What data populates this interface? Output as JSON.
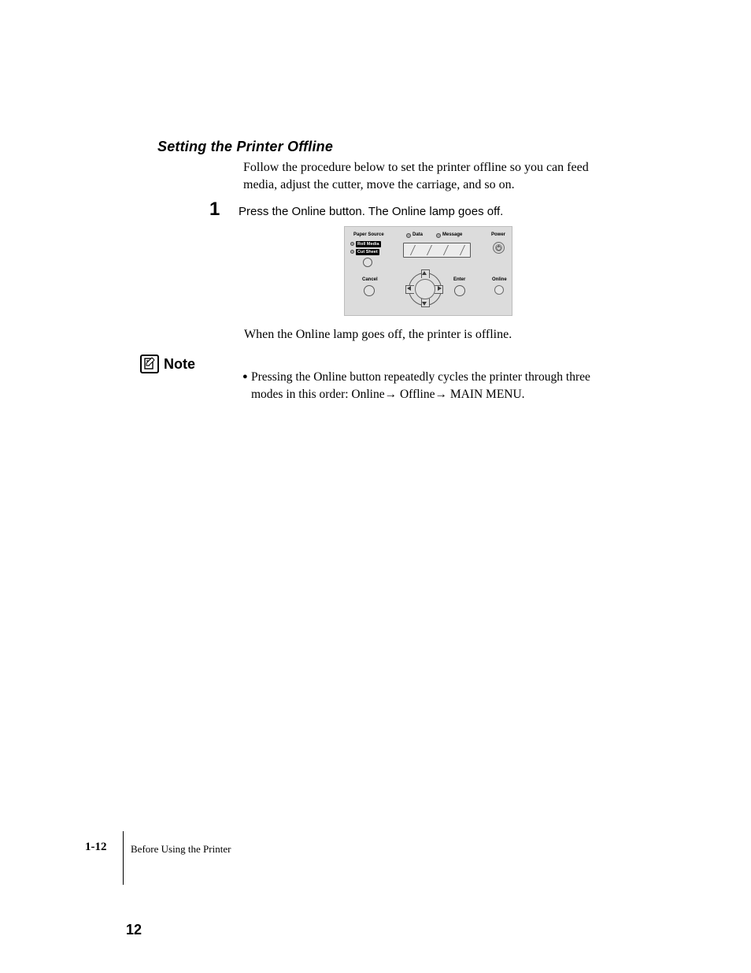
{
  "heading": "Setting the Printer Offline",
  "intro": "Follow the procedure below to set the printer offline so you can feed media, adjust the cutter, move the carriage, and so on.",
  "step1_number": "1",
  "step1_text": "Press the Online button. The Online lamp goes off.",
  "panel": {
    "paper_source": "Paper Source",
    "roll_media": "Roll Media",
    "cut_sheet": "Cut Sheet",
    "data": "Data",
    "message": "Message",
    "power": "Power",
    "cancel": "Cancel",
    "enter": "Enter",
    "online": "Online"
  },
  "after_panel": "When the Online lamp goes off, the printer is offline.",
  "note_label": "Note",
  "note_text": "Pressing the Online button repeatedly cycles the printer through three modes in this order: Online→ Offline→ MAIN MENU.",
  "footer": {
    "page_section": "1-12",
    "chapter": "Before Using the Printer",
    "abs_page": "12"
  }
}
